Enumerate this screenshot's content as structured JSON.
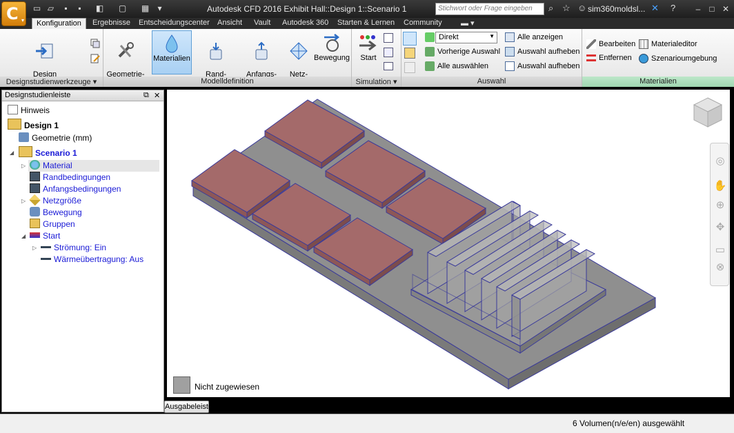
{
  "title": "Autodesk CFD 2016   Exhibit Hall::Design 1::Scenario 1",
  "search": {
    "placeholder": "Stichwort oder Frage eingeben"
  },
  "user": {
    "name": "sim360moldsl..."
  },
  "tabs": [
    {
      "label": "Konfiguration",
      "active": true
    },
    {
      "label": "Ergebnisse"
    },
    {
      "label": "Entscheidungscenter"
    },
    {
      "label": "Ansicht"
    },
    {
      "label": "Vault"
    },
    {
      "label": "Autodesk 360"
    },
    {
      "label": "Starten & Lernen"
    },
    {
      "label": "Community"
    }
  ],
  "ribbon": {
    "design_tools": {
      "title": "Designstudienwerkzeuge",
      "add_update": "Design\nhinzufügen/aktualisieren"
    },
    "model_def": {
      "title": "Modelldefinition",
      "geometry_tools": "Geometrie-\nwerkzeuge",
      "materials": "Materialien",
      "boundary": "Rand-\nbedingungen",
      "initial": "Anfangs-\nbedingungen",
      "mesh": "Netz-\ngrößen",
      "motion": "Bewegung"
    },
    "simulation": {
      "title": "Simulation",
      "start": "Start"
    },
    "selection": {
      "title": "Auswahl",
      "mode": "Direkt",
      "prev": "Vorherige Auswahl",
      "all": "Alle auswählen",
      "show_all": "Alle anzeigen",
      "deselect1": "Auswahl aufheben",
      "deselect2": "Auswahl aufheben"
    },
    "materials": {
      "title": "Materialien",
      "edit": "Bearbeiten",
      "remove": "Entfernen",
      "editor": "Materialeditor",
      "env": "Szenarioumgebung"
    }
  },
  "browser": {
    "title": "Designstudienleiste",
    "items": [
      {
        "label": "Hinweis"
      },
      {
        "label": "Design 1"
      },
      {
        "label": "Geometrie (mm)"
      },
      {
        "label": "Scenario 1"
      },
      {
        "label": "Material"
      },
      {
        "label": "Randbedingungen"
      },
      {
        "label": "Anfangsbedingungen"
      },
      {
        "label": "Netzgröße"
      },
      {
        "label": "Bewegung"
      },
      {
        "label": "Gruppen"
      },
      {
        "label": "Start"
      },
      {
        "label": "Strömung: Ein"
      },
      {
        "label": "Wärmeübertragung: Aus"
      }
    ]
  },
  "legend": {
    "label": "Nicht zugewiesen"
  },
  "output_button": "Ausgabeleiste",
  "status": "6 Volumen(n/e/en) ausgewählt",
  "colors": {
    "pad": "#a46a6a",
    "board": "#8c8c8c",
    "select": "#a8d0f3"
  }
}
